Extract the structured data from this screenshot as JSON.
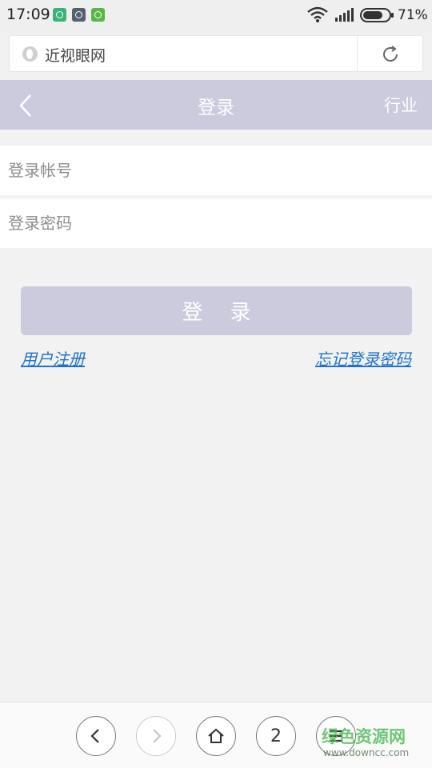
{
  "status_bar": {
    "time": "17:09",
    "battery": "71%",
    "icons": [
      "shield-app-icon",
      "gallery-app-icon",
      "android-app-icon",
      "wifi-icon",
      "signal-icon",
      "battery-icon"
    ]
  },
  "address_bar": {
    "title": "近视眼网",
    "icon": "site-icon",
    "reload_icon": "reload-icon"
  },
  "header": {
    "title": "登录",
    "right_label": "行业",
    "back_icon": "chevron-left-icon"
  },
  "form": {
    "account_placeholder": "登录帐号",
    "password_placeholder": "登录密码",
    "login_label": "登录",
    "register_link": "用户注册",
    "forgot_link": "忘记登录密码"
  },
  "bottom_nav": {
    "tab_count": "2",
    "icons": [
      "back-icon",
      "forward-icon",
      "home-icon",
      "tabs-count",
      "menu-icon"
    ]
  },
  "watermark": {
    "title": "绿色资源网",
    "url": "www.downcc.com"
  },
  "colors": {
    "header_bg": "#cbcbdd",
    "link": "#1f74c9",
    "page_bg": "#f2f2f3"
  }
}
